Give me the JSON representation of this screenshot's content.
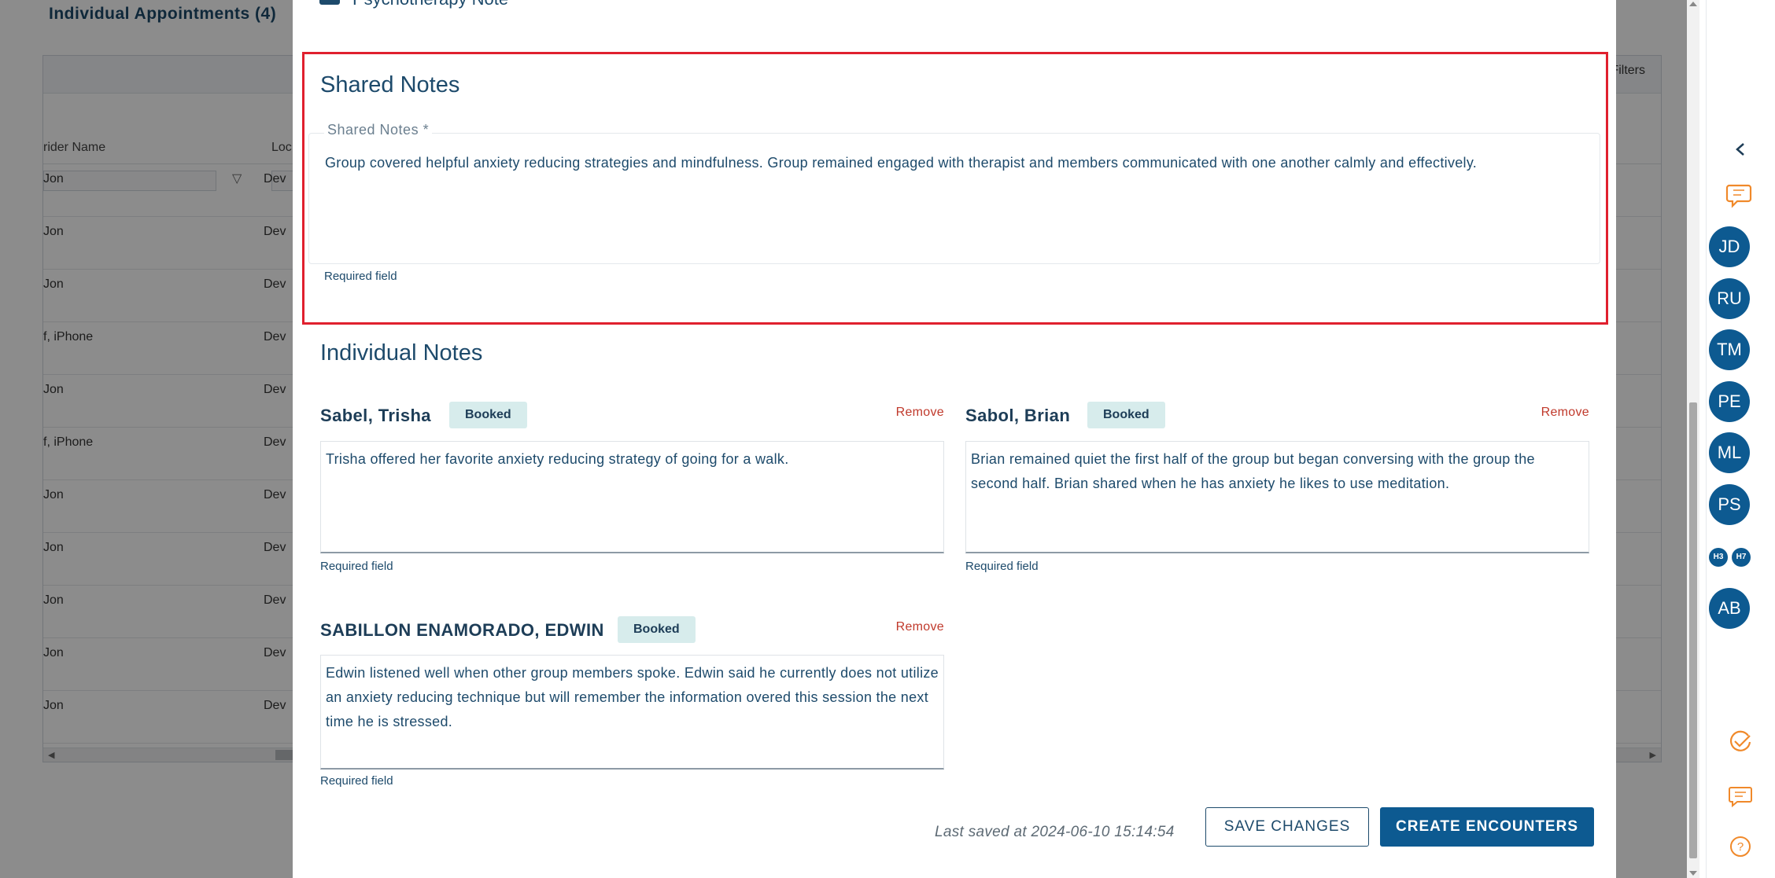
{
  "background": {
    "section_title": "Individual Appointments (4)",
    "filters_label": "Filters",
    "columns": [
      "rider Name",
      "Loc"
    ],
    "rows": [
      {
        "provider": "Jon",
        "location": "Dev"
      },
      {
        "provider": "Jon",
        "location": "Dev"
      },
      {
        "provider": "Jon",
        "location": "Dev"
      },
      {
        "provider": "f, iPhone",
        "location": "Dev"
      },
      {
        "provider": "Jon",
        "location": "Dev"
      },
      {
        "provider": "f, iPhone",
        "location": "Dev"
      },
      {
        "provider": "Jon",
        "location": "Dev"
      },
      {
        "provider": "Jon",
        "location": "Dev"
      },
      {
        "provider": "Jon",
        "location": "Dev"
      },
      {
        "provider": "Jon",
        "location": "Dev"
      },
      {
        "provider": "Jon",
        "location": "Dev"
      }
    ]
  },
  "modal": {
    "psychotherapy_label": "Psychotherapy Note",
    "shared": {
      "title": "Shared Notes",
      "field_label": "Shared Notes",
      "required_marker": "*",
      "value": "Group covered helpful anxiety reducing strategies and mindfulness. Group remained engaged with therapist and members communicated with one another calmly and effectively.",
      "required_text": "Required field"
    },
    "individual": {
      "title": "Individual Notes",
      "notes": [
        {
          "name": "Sabel, Trisha",
          "status": "Booked",
          "remove": "Remove",
          "value": "Trisha offered her favorite anxiety reducing strategy of going for a walk.",
          "required_text": "Required field"
        },
        {
          "name": "Sabol, Brian",
          "status": "Booked",
          "remove": "Remove",
          "value": "Brian remained quiet the first half of the group but began conversing with the group the second half. Brian shared when he has anxiety he likes to use meditation.",
          "required_text": "Required field"
        },
        {
          "name": "SABILLON ENAMORADO, EDWIN",
          "status": "Booked",
          "remove": "Remove",
          "value": "Edwin listened well when other group members spoke. Edwin said he currently does not utilize an anxiety reducing technique but will remember the information overed this session the next time he is stressed.",
          "required_text": "Required field"
        }
      ]
    },
    "footer": {
      "last_saved": "Last saved at 2024-06-10 15:14:54",
      "save_label": "SAVE CHANGES",
      "create_label": "CREATE ENCOUNTERS"
    }
  },
  "rail": {
    "avatars": [
      "JD",
      "RU",
      "TM",
      "PE",
      "ML",
      "PS"
    ],
    "mini_avatars": [
      "H3",
      "H7"
    ],
    "last_avatar": "AB",
    "icons": [
      "chevron-left-icon",
      "chat-bubbles-icon",
      "check-circle-icon",
      "message-icon",
      "help-icon"
    ]
  },
  "colors": {
    "primary": "#0d5a91",
    "text": "#1d4a6b",
    "highlight_border": "#e0202e",
    "remove": "#c0392b",
    "badge_bg": "#d7ecec",
    "accent_orange": "#f0892a"
  }
}
